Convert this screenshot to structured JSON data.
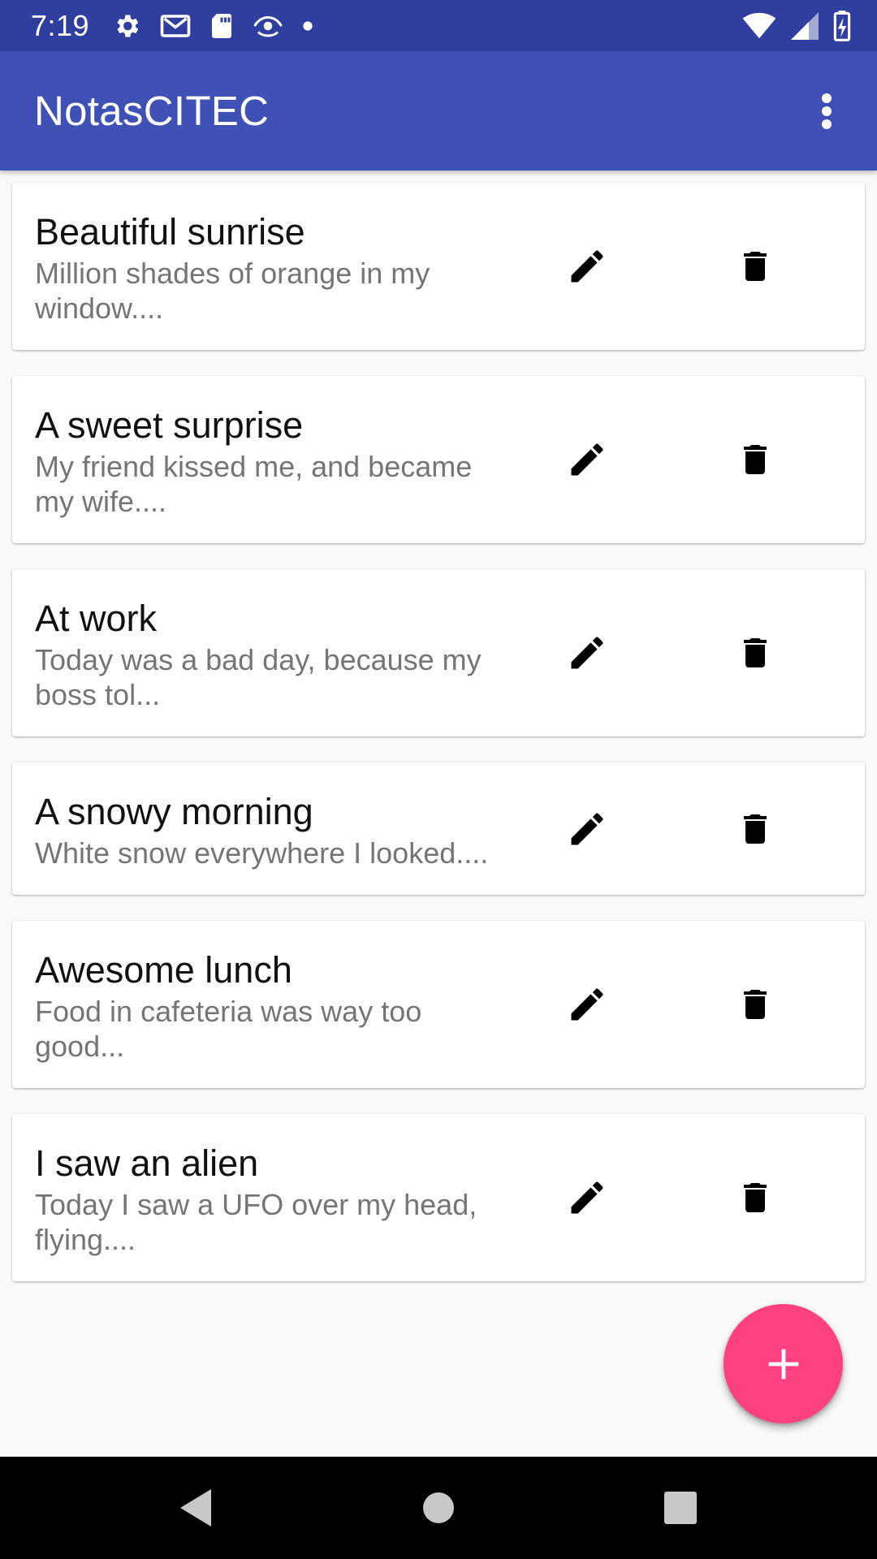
{
  "status_bar": {
    "time": "7:19",
    "left_icons": [
      "gear-icon",
      "gmail-icon",
      "sd-card-icon",
      "eye-cast-icon",
      "dot-icon"
    ],
    "right_icons": [
      "wifi-icon",
      "cell-signal-icon",
      "battery-icon"
    ]
  },
  "app_bar": {
    "title": "NotasCITEC",
    "overflow_icon": "more-vert-icon"
  },
  "notes": [
    {
      "title": "Beautiful sunrise",
      "body": "Million shades of orange in my window...."
    },
    {
      "title": "A sweet surprise",
      "body": "My friend kissed me, and became my wife...."
    },
    {
      "title": "At work",
      "body": "Today was a bad day, because my boss tol..."
    },
    {
      "title": "A snowy morning",
      "body": "White snow everywhere I looked...."
    },
    {
      "title": "Awesome lunch",
      "body": "Food in cafeteria was way too good..."
    },
    {
      "title": "I saw an alien",
      "body": "Today I saw a UFO over my head, flying...."
    }
  ],
  "card_actions": {
    "edit_icon": "pencil-icon",
    "delete_icon": "trash-icon"
  },
  "fab": {
    "icon": "plus-icon",
    "color": "#ff4081"
  },
  "colors": {
    "primary": "#3f51b5",
    "primary_dark": "#303f9f",
    "accent": "#ff4081"
  },
  "nav_bar": {
    "buttons": [
      "back-icon",
      "home-icon",
      "recents-icon"
    ]
  }
}
